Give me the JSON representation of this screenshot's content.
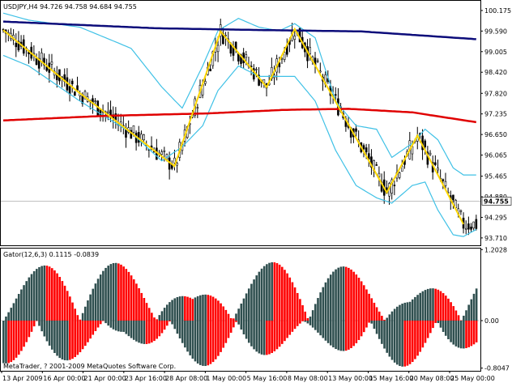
{
  "colors": {
    "background": "#ffffff",
    "candle": "#000000",
    "zigzag": "#ffd700",
    "bands": "#3fc1e6",
    "slow_ma": "#0c0c7a",
    "mid_ma": "#e00000",
    "gator_up": "#2f4f4f",
    "gator_down": "#ff0000",
    "price_line": "#c0c0c0",
    "text": "#000000"
  },
  "chart_data": [
    {
      "type": "candlestick",
      "header": "USDJPY,H4  94.726 94.758 94.684 94.755",
      "current_price": "94.755",
      "ylim": [
        93.5,
        100.45
      ],
      "y_ticks": [
        "100.175",
        "99.590",
        "99.005",
        "98.420",
        "97.820",
        "97.235",
        "96.650",
        "96.065",
        "95.465",
        "94.880",
        "94.295",
        "93.710"
      ],
      "x_ticks": [
        "13 Apr 2009",
        "16 Apr 00:00",
        "21 Apr 00:00",
        "23 Apr 16:00",
        "28 Apr 08:00",
        "1 May 00:00",
        "5 May 16:00",
        "8 May 08:00",
        "13 May 00:00",
        "15 May 16:00",
        "20 May 08:00",
        "25 May 00:00"
      ],
      "zigzag": [
        [
          0,
          99.62
        ],
        [
          29,
          97.88
        ],
        [
          67,
          95.75
        ],
        [
          85,
          99.58
        ],
        [
          103,
          98.0
        ],
        [
          114,
          99.65
        ],
        [
          150,
          95.0
        ],
        [
          162,
          96.62
        ],
        [
          180,
          94.1
        ]
      ],
      "slow_ma": [
        [
          0,
          99.86
        ],
        [
          60,
          99.67
        ],
        [
          100,
          99.62
        ],
        [
          140,
          99.58
        ],
        [
          185,
          99.36
        ]
      ],
      "mid_ma": [
        [
          0,
          97.05
        ],
        [
          40,
          97.18
        ],
        [
          80,
          97.25
        ],
        [
          110,
          97.35
        ],
        [
          135,
          97.38
        ],
        [
          160,
          97.28
        ],
        [
          185,
          97.0
        ]
      ],
      "upper_band": [
        [
          0,
          100.1
        ],
        [
          10,
          99.9
        ],
        [
          30,
          99.7
        ],
        [
          50,
          99.1
        ],
        [
          62,
          98.0
        ],
        [
          70,
          97.4
        ],
        [
          78,
          98.6
        ],
        [
          84,
          99.6
        ],
        [
          92,
          99.95
        ],
        [
          100,
          99.7
        ],
        [
          108,
          99.6
        ],
        [
          114,
          99.8
        ],
        [
          122,
          99.4
        ],
        [
          130,
          97.6
        ],
        [
          138,
          96.9
        ],
        [
          146,
          96.8
        ],
        [
          152,
          96.0
        ],
        [
          160,
          96.4
        ],
        [
          165,
          96.8
        ],
        [
          170,
          96.5
        ],
        [
          176,
          95.7
        ],
        [
          180,
          95.5
        ],
        [
          185,
          95.5
        ]
      ],
      "lower_band": [
        [
          0,
          98.9
        ],
        [
          10,
          98.6
        ],
        [
          30,
          97.6
        ],
        [
          50,
          96.7
        ],
        [
          62,
          95.9
        ],
        [
          70,
          96.3
        ],
        [
          78,
          96.9
        ],
        [
          84,
          97.9
        ],
        [
          92,
          98.6
        ],
        [
          100,
          98.3
        ],
        [
          108,
          98.3
        ],
        [
          114,
          98.3
        ],
        [
          122,
          97.6
        ],
        [
          130,
          96.2
        ],
        [
          138,
          95.2
        ],
        [
          146,
          94.85
        ],
        [
          152,
          94.7
        ],
        [
          160,
          95.2
        ],
        [
          165,
          95.3
        ],
        [
          170,
          94.5
        ],
        [
          176,
          93.8
        ],
        [
          180,
          93.75
        ],
        [
          185,
          93.95
        ]
      ]
    },
    {
      "type": "histogram",
      "header": "Gator(12,6,3)  0.1115  -0.0839",
      "ylim": [
        -0.85,
        1.22
      ],
      "y_ticks": [
        "1.2028",
        "0.00",
        "-0.8047"
      ]
    }
  ],
  "footer": "MetaTrader, ? 2001-2009 MetaQuotes Software Corp."
}
